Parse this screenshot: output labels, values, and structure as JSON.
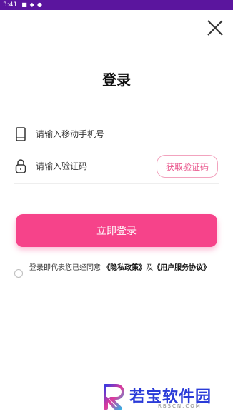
{
  "status_bar": {
    "time": "3:41"
  },
  "page": {
    "title": "登录"
  },
  "phone_field": {
    "placeholder": "请输入移动手机号",
    "icon": "phone-icon"
  },
  "code_field": {
    "placeholder": "请输入验证码",
    "icon": "lock-icon"
  },
  "get_code_button": {
    "label": "获取验证码"
  },
  "login_button": {
    "label": "立即登录"
  },
  "agreement": {
    "prefix": "登录即代表您已经同意 ",
    "privacy_link": "《隐私政策》",
    "connector": "及",
    "terms_link": "《用户服务协议》"
  },
  "watermark": {
    "name": "若宝软件园",
    "domain": "RBSCN.COM"
  },
  "colors": {
    "accent": "#f6438a",
    "status_bar": "#5b159e",
    "code_button_text": "#ea5a8f",
    "code_button_border": "#f2a3be"
  }
}
